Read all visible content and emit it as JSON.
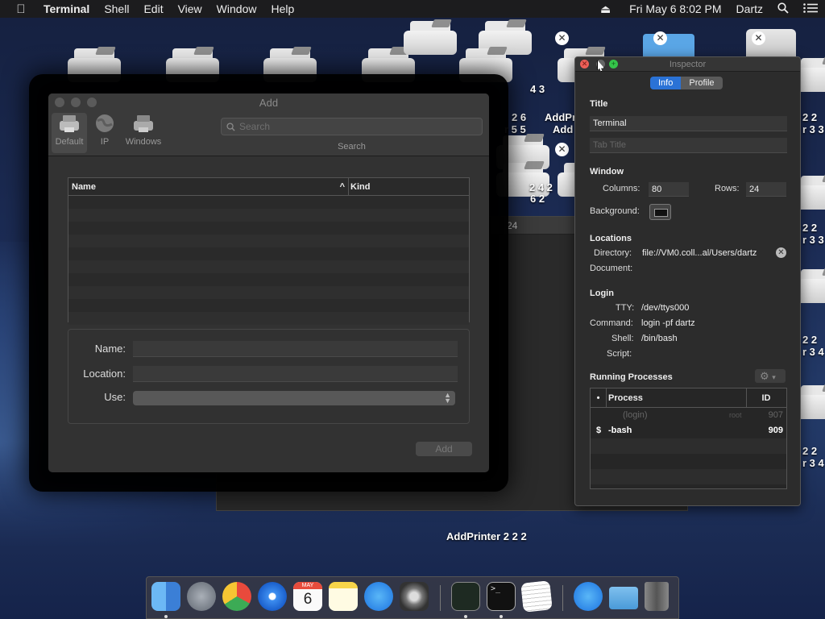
{
  "menubar": {
    "apple": "",
    "items": [
      "Terminal",
      "Shell",
      "Edit",
      "View",
      "Window",
      "Help"
    ],
    "eject": "⏏",
    "datetime": "Fri May 6  8:02 PM",
    "user": "Dartz",
    "search_icon": "search-icon",
    "menu_icon": "list-icon"
  },
  "desktop": {
    "labels": {
      "l1": "4 3",
      "l2": "2 6",
      "l3": "AddPr",
      "l4": "r 5 5",
      "l5": "Add",
      "l6": "2 4 2",
      "l7": "6 2",
      "l8": "2 2",
      "l9": "r 3 3",
      "l10": "2 2",
      "l11": "r 3 3",
      "l12": "2 2",
      "l13": "r 3 4",
      "l14": "2 2",
      "l15": "r 3 4",
      "l16": "AddPrinter 2 2 2"
    }
  },
  "bgwindow": {
    "number": "24"
  },
  "addwin": {
    "title": "Add",
    "tools": {
      "default": "Default",
      "ip": "IP",
      "windows": "Windows"
    },
    "search_placeholder": "Search",
    "search_label": "Search",
    "table": {
      "col_name": "Name",
      "col_kind": "Kind"
    },
    "form": {
      "name_label": "Name:",
      "location_label": "Location:",
      "use_label": "Use:"
    },
    "add_button": "Add"
  },
  "inspector": {
    "title": "Inspector",
    "tabs": {
      "info": "Info",
      "profile": "Profile"
    },
    "title_section": "Title",
    "title_value": "Terminal",
    "tab_title_placeholder": "Tab Title",
    "window_section": "Window",
    "columns_label": "Columns:",
    "columns_value": "80",
    "rows_label": "Rows:",
    "rows_value": "24",
    "background_label": "Background:",
    "locations_section": "Locations",
    "directory_label": "Directory:",
    "directory_value": "file://VM0.coll...al/Users/dartz",
    "document_label": "Document:",
    "login_section": "Login",
    "tty_label": "TTY:",
    "tty_value": "/dev/ttys000",
    "command_label": "Command:",
    "command_value": "login -pf dartz",
    "shell_label": "Shell:",
    "shell_value": "/bin/bash",
    "script_label": "Script:",
    "processes_section": "Running Processes",
    "proc_headers": {
      "mark": "•",
      "process": "Process",
      "id": "ID"
    },
    "processes": [
      {
        "mark": "",
        "name": "(login)",
        "user": "root",
        "id": "907"
      },
      {
        "mark": "$",
        "name": "-bash",
        "user": "",
        "id": "909"
      }
    ]
  },
  "dock": {
    "apps": [
      "finder-icon",
      "launchpad-icon",
      "chrome-icon",
      "safari-icon",
      "calendar-icon",
      "notes-icon",
      "app-store-icon",
      "system-preferences-icon",
      "activity-monitor-icon",
      "terminal-icon",
      "textedit-icon",
      "app-store-icon",
      "downloads-folder-icon",
      "trash-icon"
    ],
    "calendar_month": "MAY",
    "calendar_day": "6"
  }
}
